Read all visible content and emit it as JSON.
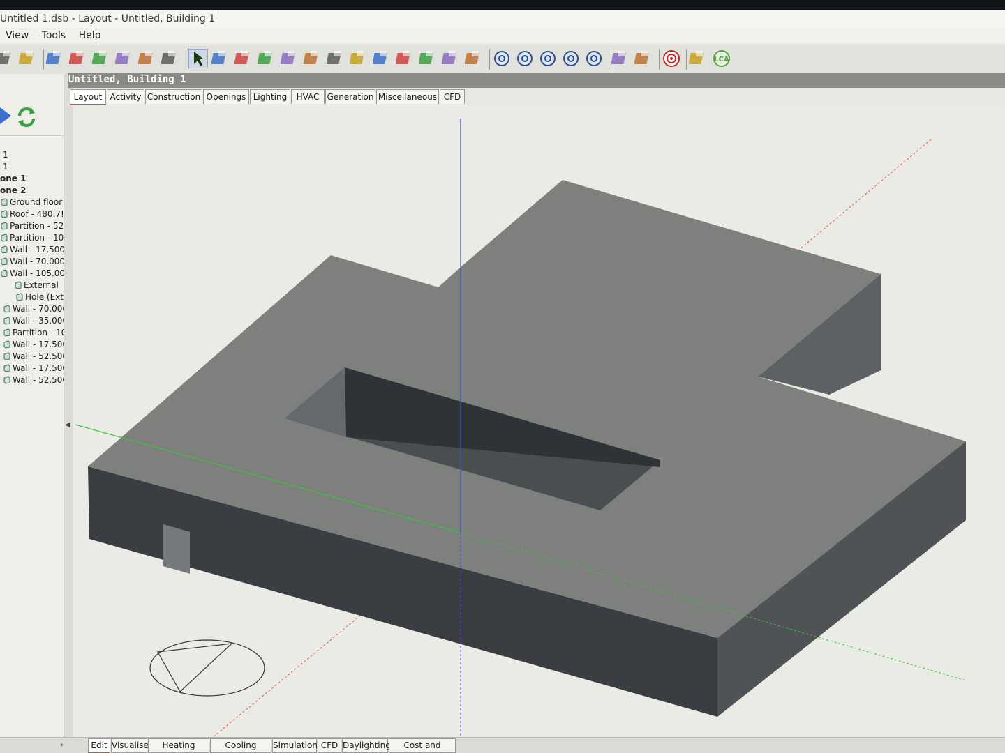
{
  "window": {
    "title": "Untitled 1.dsb - Layout - Untitled, Building 1"
  },
  "menu": {
    "items": [
      "View",
      "Tools",
      "Help"
    ]
  },
  "toolbar": {
    "icons": [
      "open-icon",
      "edit-icon",
      "wrench-icon",
      "grid-icon",
      "eraser-icon",
      "block-icon",
      "stack-icon",
      "gear-icon",
      "select-arrow-icon",
      "rotate-icon",
      "move-icon",
      "add-block-icon",
      "add-zone-icon",
      "draw-icon",
      "cut-icon",
      "stamp-icon",
      "merge-icon",
      "paint-icon",
      "box-icon",
      "line-icon",
      "measure-icon",
      "orbit-icon",
      "zoom-in-icon",
      "zoom-out-icon",
      "zoom-fit-icon",
      "zoom-window-icon",
      "report-icon",
      "table-icon",
      "target-icon",
      "sheet-icon",
      "lca-icon"
    ],
    "lca_label": "LCA"
  },
  "building": {
    "title": "Untitled, Building 1"
  },
  "tabs": [
    "Layout",
    "Activity",
    "Construction",
    "Openings",
    "Lighting",
    "HVAC",
    "Generation",
    "Miscellaneous",
    "CFD"
  ],
  "active_tab": "Layout",
  "tree": {
    "nodes": [
      {
        "label": "1",
        "bold": false
      },
      {
        "label": "1",
        "bold": false
      },
      {
        "label": "one 1",
        "bold": true
      },
      {
        "label": "one 2",
        "bold": true
      },
      {
        "label": "Ground floor",
        "bold": false
      },
      {
        "label": "Roof - 480.7!",
        "bold": false
      },
      {
        "label": "Partition - 52.",
        "bold": false
      },
      {
        "label": "Partition - 10.",
        "bold": false
      },
      {
        "label": "Wall - 17.500",
        "bold": false
      },
      {
        "label": "Wall - 70.000",
        "bold": false
      },
      {
        "label": "Wall - 105.00",
        "bold": false
      },
      {
        "label": "External",
        "bold": false
      },
      {
        "label": "Hole (Ext",
        "bold": false
      },
      {
        "label": "Wall - 70.000",
        "bold": false
      },
      {
        "label": "Wall - 35.000",
        "bold": false
      },
      {
        "label": "Partition - 10.",
        "bold": false
      },
      {
        "label": "Wall - 17.500",
        "bold": false
      },
      {
        "label": "Wall - 52.500",
        "bold": false
      },
      {
        "label": "Wall - 17.500",
        "bold": false
      },
      {
        "label": "Wall - 52.500",
        "bold": false
      }
    ]
  },
  "bottom_tabs": [
    "Edit",
    "Visualise",
    "Heating design",
    "Cooling design",
    "Simulation",
    "CFD",
    "Daylighting",
    "Cost and Carbon"
  ],
  "active_bottom_tab": "Edit",
  "colors": {
    "model_top": "#7d7e7c",
    "model_front": "#3c4044",
    "model_side": "#585b5d",
    "axis_x": "#e05050",
    "axis_y": "#3cc43c",
    "axis_z": "#3a4fd8",
    "tab_accent": "#e0463c"
  }
}
